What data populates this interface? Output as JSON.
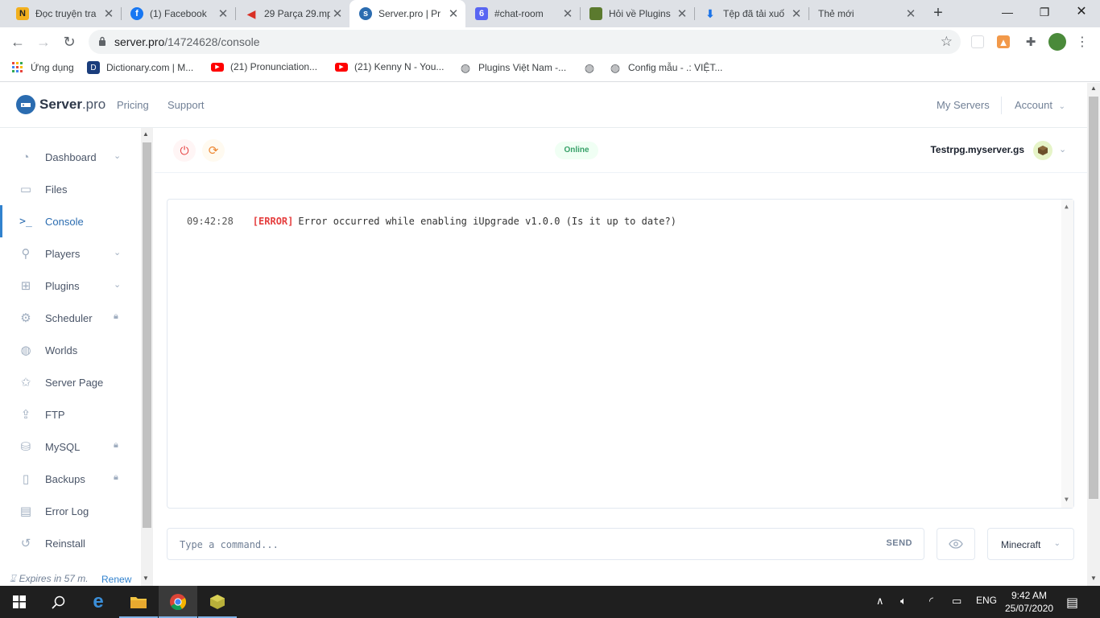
{
  "browser": {
    "tabs": [
      {
        "title": "Đọc truyện tra",
        "icon": "N",
        "icon_color": "#f2b01e"
      },
      {
        "title": "(1) Facebook",
        "icon": "f",
        "icon_color": "#1877f2"
      },
      {
        "title": "29 Parça 29.mp",
        "icon": "speaker",
        "icon_color": "#d93025"
      },
      {
        "title": "Server.pro | Pr",
        "icon": "s",
        "icon_color": "#2b6cb0"
      },
      {
        "title": "#chat-room",
        "icon": "6",
        "icon_color": "#5865f2"
      },
      {
        "title": "Hỏi về Plugins",
        "icon": "block",
        "icon_color": "#5b7a2e"
      },
      {
        "title": "Tệp đã tải xuố",
        "icon": "download",
        "icon_color": "#1a73e8"
      },
      {
        "title": "Thẻ mới",
        "icon": "",
        "icon_color": ""
      }
    ],
    "url_host": "server.pro",
    "url_path": "/14724628/console",
    "bookmarks": [
      {
        "label": "Ứng dụng"
      },
      {
        "label": "Dictionary.com | M..."
      },
      {
        "label": "(21) Pronunciation..."
      },
      {
        "label": "(21) Kenny N - You..."
      },
      {
        "label": "Plugins Việt Nam -..."
      },
      {
        "label": ""
      },
      {
        "label": "Config mẫu - .: VIỆT..."
      }
    ]
  },
  "site": {
    "logo_main": "Server",
    "logo_suffix": ".pro",
    "nav": {
      "pricing": "Pricing",
      "support": "Support",
      "my_servers": "My Servers",
      "account": "Account"
    },
    "accent": "#3182ce"
  },
  "sidebar": {
    "items": [
      {
        "label": "Dashboard",
        "right": "chevron"
      },
      {
        "label": "Files",
        "right": ""
      },
      {
        "label": "Console",
        "right": "",
        "active": true
      },
      {
        "label": "Players",
        "right": "chevron"
      },
      {
        "label": "Plugins",
        "right": "chevron"
      },
      {
        "label": "Scheduler",
        "right": "lock"
      },
      {
        "label": "Worlds",
        "right": ""
      },
      {
        "label": "Server Page",
        "right": ""
      },
      {
        "label": "FTP",
        "right": ""
      },
      {
        "label": "MySQL",
        "right": "lock"
      },
      {
        "label": "Backups",
        "right": "lock"
      },
      {
        "label": "Error Log",
        "right": ""
      },
      {
        "label": "Reinstall",
        "right": ""
      }
    ],
    "expires": "Expires in 57 m.",
    "renew": "Renew"
  },
  "server": {
    "status": "Online",
    "name": "Testrpg.myserver.gs"
  },
  "console": {
    "lines": [
      {
        "time": "09:42:28",
        "level": "[ERROR]",
        "message": "Error occurred while enabling iUpgrade v1.0.0 (Is it up to date?)"
      }
    ],
    "command_placeholder": "Type a command...",
    "send_label": "SEND",
    "type_value": "Minecraft"
  },
  "taskbar": {
    "lang": "ENG",
    "time": "9:42 AM",
    "date": "25/07/2020"
  }
}
